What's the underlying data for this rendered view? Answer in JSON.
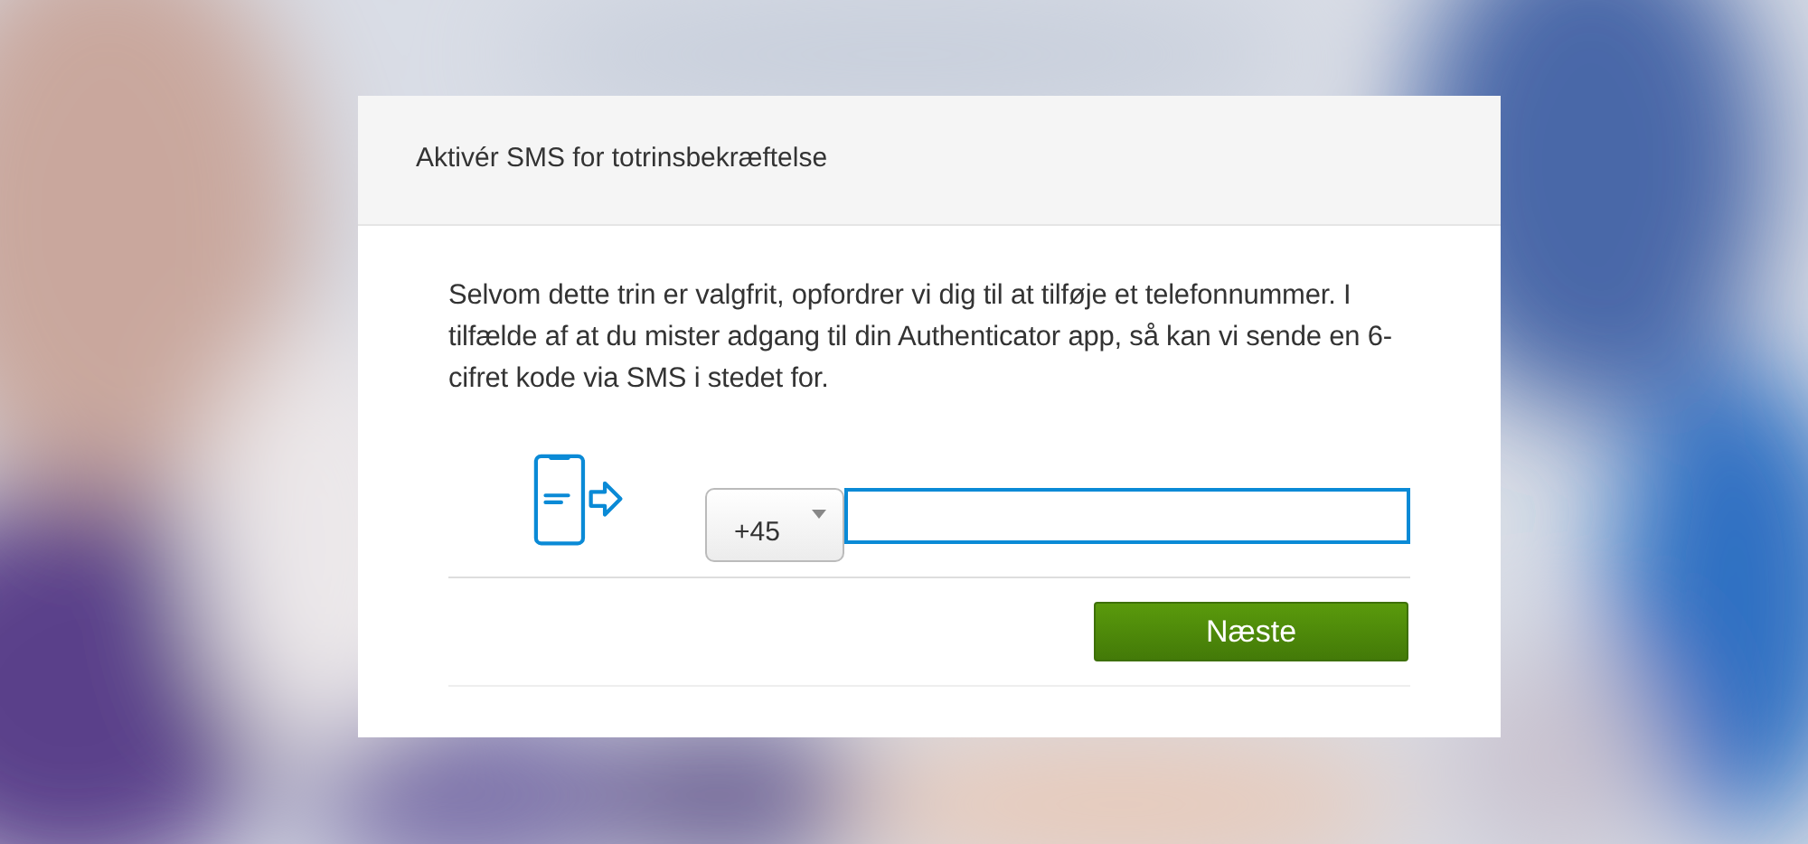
{
  "dialog": {
    "title": "Aktivér SMS for totrinsbekræftelse",
    "description": "Selvom dette trin er valgfrit, opfordrer vi dig til at tilføje et telefonnummer. I tilfælde af at du mister adgang til din Authenticator app, så kan vi sende en 6-cifret kode via SMS i stedet for.",
    "country_code": {
      "value": "+45"
    },
    "phone_field": {
      "focused": true
    },
    "buttons": [
      {
        "label": "Næste"
      }
    ]
  }
}
